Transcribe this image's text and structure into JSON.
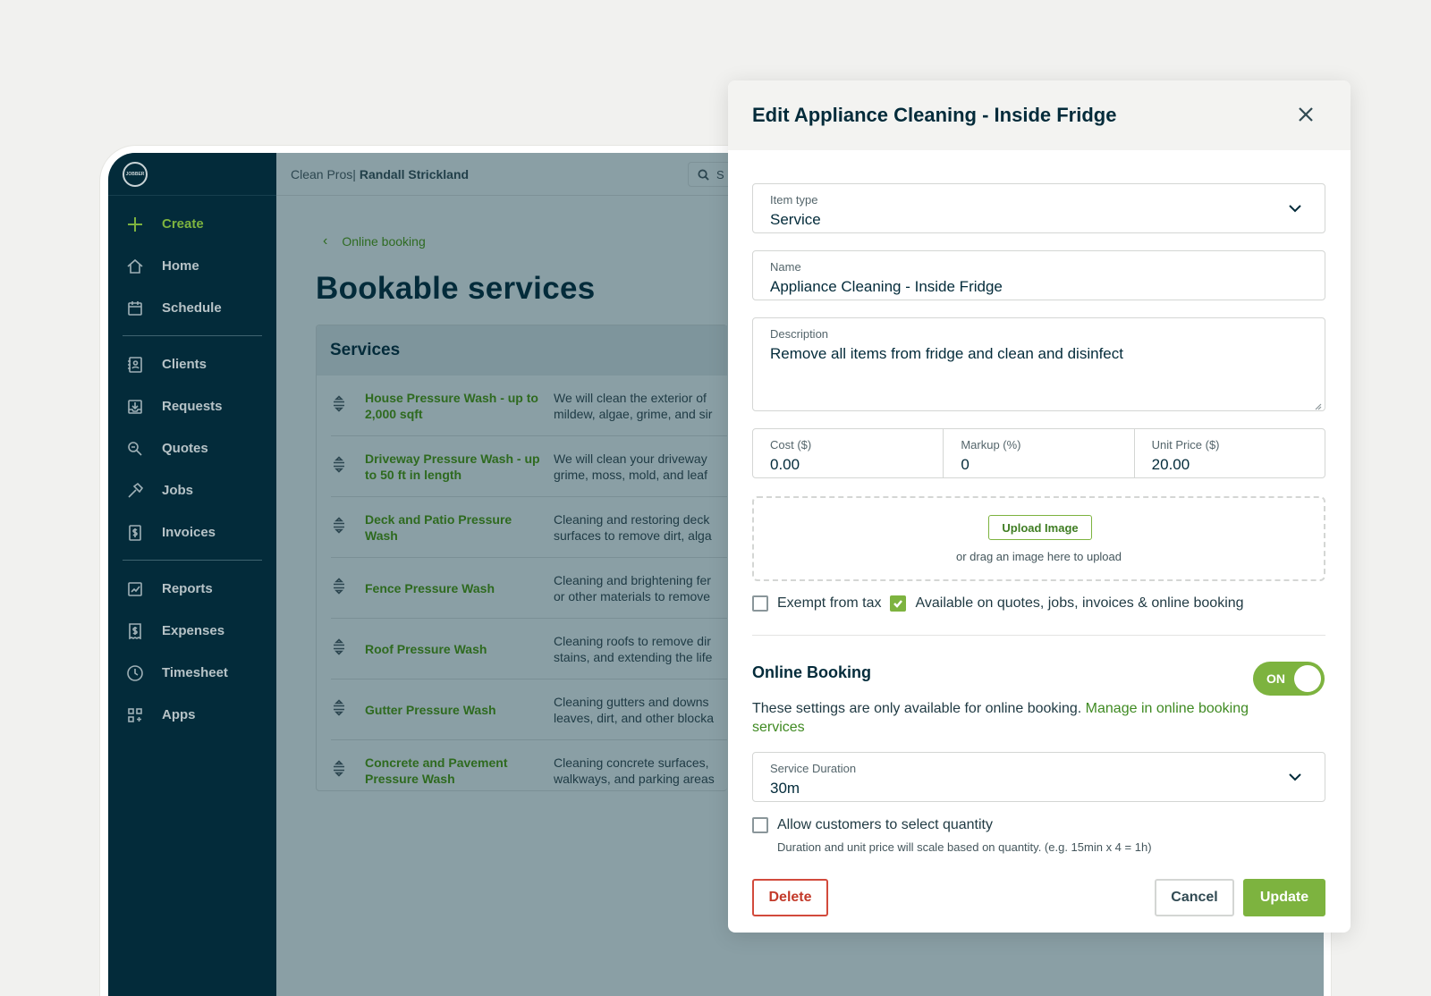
{
  "app": {
    "logo_text": "JOBBER",
    "company": "Clean Pros|",
    "user": "Randall Strickland",
    "search_placeholder": "S"
  },
  "sidebar": {
    "items": [
      {
        "label": "Create",
        "icon": "plus-icon"
      },
      {
        "label": "Home",
        "icon": "home-icon"
      },
      {
        "label": "Schedule",
        "icon": "calendar-icon"
      },
      {
        "label": "Clients",
        "icon": "contact-book-icon"
      },
      {
        "label": "Requests",
        "icon": "inbox-download-icon"
      },
      {
        "label": "Quotes",
        "icon": "quote-magnifier-icon"
      },
      {
        "label": "Jobs",
        "icon": "hammer-icon"
      },
      {
        "label": "Invoices",
        "icon": "invoice-dollar-icon"
      },
      {
        "label": "Reports",
        "icon": "chart-icon"
      },
      {
        "label": "Expenses",
        "icon": "receipt-dollar-icon"
      },
      {
        "label": "Timesheet",
        "icon": "clock-icon"
      },
      {
        "label": "Apps",
        "icon": "apps-grid-icon"
      }
    ]
  },
  "main": {
    "back_label": "Online booking",
    "title": "Bookable services",
    "card_title": "Services",
    "services": [
      {
        "name": "House Pressure Wash - up to 2,000 sqft",
        "desc_line1": "We will clean the exterior of",
        "desc_line2": "mildew, algae, grime, and sir"
      },
      {
        "name": "Driveway Pressure Wash - up to 50 ft in length",
        "desc_line1": "We will clean your driveway",
        "desc_line2": "grime, moss, mold, and leaf"
      },
      {
        "name": "Deck and Patio Pressure Wash",
        "desc_line1": "Cleaning and restoring deck",
        "desc_line2": "surfaces to remove dirt, alga"
      },
      {
        "name": "Fence Pressure Wash",
        "desc_line1": "Cleaning and brightening fer",
        "desc_line2": "or other materials to remove"
      },
      {
        "name": "Roof Pressure Wash",
        "desc_line1": "Cleaning roofs to remove dir",
        "desc_line2": "stains, and extending the life"
      },
      {
        "name": "Gutter Pressure Wash",
        "desc_line1": "Cleaning gutters and downs",
        "desc_line2": "leaves, dirt, and other blocka"
      },
      {
        "name": "Concrete and Pavement Pressure Wash",
        "desc_line1": "Cleaning concrete surfaces,",
        "desc_line2": "walkways, and parking areas"
      }
    ]
  },
  "modal": {
    "title": "Edit Appliance Cleaning - Inside Fridge",
    "item_type_label": "Item type",
    "item_type_value": "Service",
    "name_label": "Name",
    "name_value": "Appliance Cleaning - Inside Fridge",
    "description_label": "Description",
    "description_value": "Remove all items from fridge and clean and disinfect",
    "cost_label": "Cost ($)",
    "cost_value": "0.00",
    "markup_label": "Markup (%)",
    "markup_value": "0",
    "unit_price_label": "Unit Price ($)",
    "unit_price_value": "20.00",
    "upload_button": "Upload Image",
    "upload_hint": "or drag an image here to upload",
    "exempt_label": "Exempt from tax",
    "exempt_checked": false,
    "available_label": "Available on quotes, jobs, invoices & online booking",
    "available_checked": true,
    "online_booking_title": "Online Booking",
    "toggle_label": "ON",
    "toggle_on": true,
    "online_booking_text": "These settings are only available for online booking. ",
    "online_booking_link": "Manage in online booking services",
    "duration_label": "Service Duration",
    "duration_value": "30m",
    "allow_qty_label": "Allow customers to select quantity",
    "allow_qty_checked": false,
    "allow_qty_hint": "Duration and unit price will scale based on quantity. (e.g. 15min x 4 = 1h)",
    "delete_button": "Delete",
    "cancel_button": "Cancel",
    "update_button": "Update"
  },
  "colors": {
    "brand_green": "#7db33f",
    "sidebar_bg": "#032b3a",
    "danger": "#c33a2a",
    "overlay": "#8a9fa5"
  }
}
